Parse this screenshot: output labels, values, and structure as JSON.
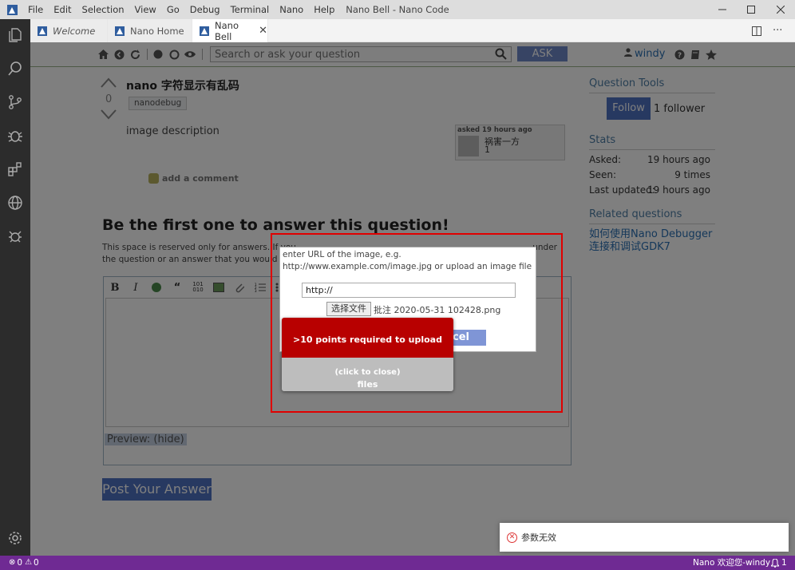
{
  "window": {
    "title": "Nano Bell - Nano Code"
  },
  "menu": [
    "File",
    "Edit",
    "Selection",
    "View",
    "Go",
    "Debug",
    "Terminal",
    "Nano",
    "Help"
  ],
  "tabs": [
    {
      "label": "Welcome",
      "italic": true,
      "active": false
    },
    {
      "label": "Nano Home",
      "active": false
    },
    {
      "label": "Nano Bell",
      "active": true
    }
  ],
  "site_header": {
    "search_placeholder": "Search or ask your question",
    "ask_label": "ASK",
    "username": "windy"
  },
  "question": {
    "votes": "0",
    "title": "nano 字符显示有乱码",
    "tag": "nanodebug",
    "image_alt": "image description",
    "asked_label": "asked 19 hours ago",
    "asker_name": "祸害一方",
    "asker_karma": "1",
    "add_comment": "add a comment"
  },
  "answer": {
    "heading": "Be the first one to answer this question!",
    "desc_part1": "This space is reserved only for answers. If you",
    "desc_part2": "under",
    "desc_part3": "the question or an answer that you would like to",
    "preview_label": "Preview: (hide)",
    "post_label": "Post Your Answer"
  },
  "sidebar": {
    "tools_heading": "Question Tools",
    "follow_label": "Follow",
    "follower_count": "1 follower",
    "stats_heading": "Stats",
    "stats": [
      {
        "label": "Asked:",
        "value": "19 hours ago"
      },
      {
        "label": "Seen:",
        "value": "9 times"
      },
      {
        "label": "Last updated:",
        "value": "19 hours ago"
      }
    ],
    "related_heading": "Related questions",
    "related_link": "如何使用Nano Debugger连接和调试GDK7"
  },
  "dialog": {
    "message": "enter URL of the image, e.g. http://www.example.com/image.jpg or upload an image file",
    "url_value": "http://",
    "choose_file": "选择文件",
    "file_name": "批注 2020-05-31 102428.png",
    "cancel_label": "cel"
  },
  "notification": {
    "message": ">10 points required to upload files",
    "close_hint": "(click to close)"
  },
  "toast": {
    "message": "参数无效"
  },
  "statusbar": {
    "errors": "0",
    "warnings": "0",
    "right_text": "Nano 欢迎您-windy",
    "bell_count": "1"
  },
  "colors": {
    "statusbar": "#6f2a93",
    "activitybar": "#2c2c2c",
    "highlight": "#e00000",
    "notify": "#b80000",
    "button": "#4f72c2"
  }
}
